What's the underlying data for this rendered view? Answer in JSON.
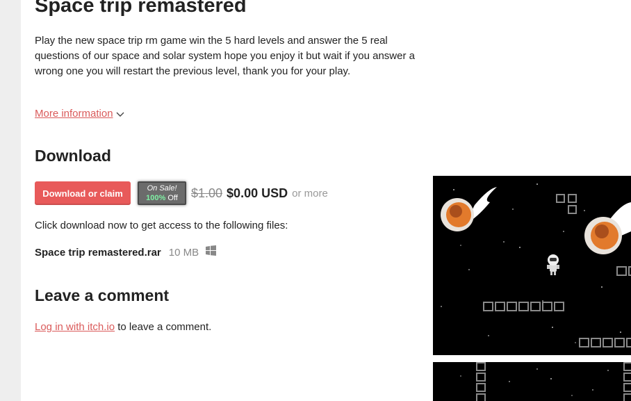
{
  "game": {
    "title": "Space trip remastered",
    "description": "Play the new space trip rm game win the 5 hard levels and answer the 5 real questions of our space and solar system hope you enjoy it but wait if you answer a wrong one you will restart the previous level,  thank you for your play.",
    "more_info_label": "More information"
  },
  "download": {
    "heading": "Download",
    "button_label": "Download or claim",
    "sale": {
      "on_sale": "On Sale!",
      "percent": "100%",
      "off": " Off"
    },
    "original_price": "$1.00",
    "price": "$0.00 USD",
    "or_more": "or more",
    "files_note": "Click download now to get access to the following files:",
    "files": [
      {
        "name": "Space trip remastered.rar",
        "size": "10 MB",
        "platform_icon": "windows-icon"
      }
    ]
  },
  "comments": {
    "heading": "Leave a comment",
    "login_link": "Log in with itch.io",
    "login_suffix": " to leave a comment."
  },
  "colors": {
    "accent": "#e85a5a",
    "link": "#da5a5a",
    "sale_green": "#7ff0a4",
    "sidebar_bg": "#eeeeee"
  }
}
